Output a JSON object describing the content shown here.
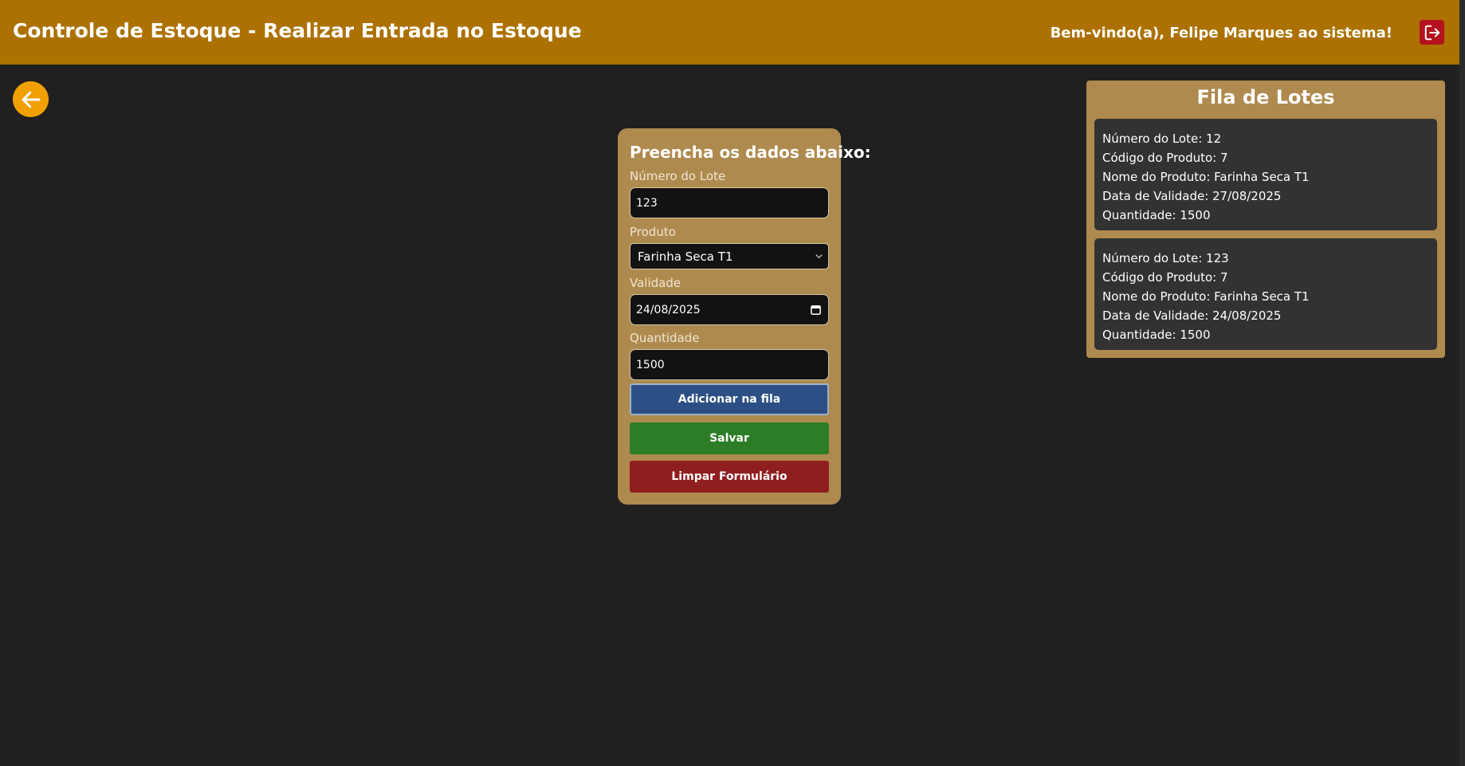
{
  "header": {
    "title": "Controle de Estoque - Realizar Entrada no Estoque",
    "welcome": "Bem-vindo(a), Felipe Marques ao sistema!",
    "logout_icon": "logout-icon"
  },
  "nav": {
    "back_icon": "arrow-left-icon"
  },
  "form": {
    "title": "Preencha os dados abaixo:",
    "lote_label": "Número do Lote",
    "lote_value": "123",
    "produto_label": "Produto",
    "produto_value": "Farinha Seca T1",
    "validade_label": "Validade",
    "validade_value": "24/08/2025",
    "quantidade_label": "Quantidade",
    "quantidade_value": "1500",
    "add_button": "Adicionar na fila",
    "save_button": "Salvar",
    "clear_button": "Limpar Formulário"
  },
  "queue": {
    "title": "Fila de Lotes",
    "items": [
      {
        "lote": "Número do Lote: 12",
        "codigo": "Código do Produto: 7",
        "nome": "Nome do Produto: Farinha Seca T1",
        "validade": "Data de Validade: 27/08/2025",
        "quantidade": "Quantidade: 1500"
      },
      {
        "lote": "Número do Lote: 123",
        "codigo": "Código do Produto: 7",
        "nome": "Nome do Produto: Farinha Seca T1",
        "validade": "Data de Validade: 24/08/2025",
        "quantidade": "Quantidade: 1500"
      }
    ]
  },
  "colors": {
    "header": "#ac7100",
    "background": "#202020",
    "card": "#ae8a4e",
    "add_button": "#2c5085",
    "save_button": "#2d7d27",
    "clear_button": "#8f1f1f",
    "logout": "#b3121e",
    "back_button": "#f0a000"
  }
}
